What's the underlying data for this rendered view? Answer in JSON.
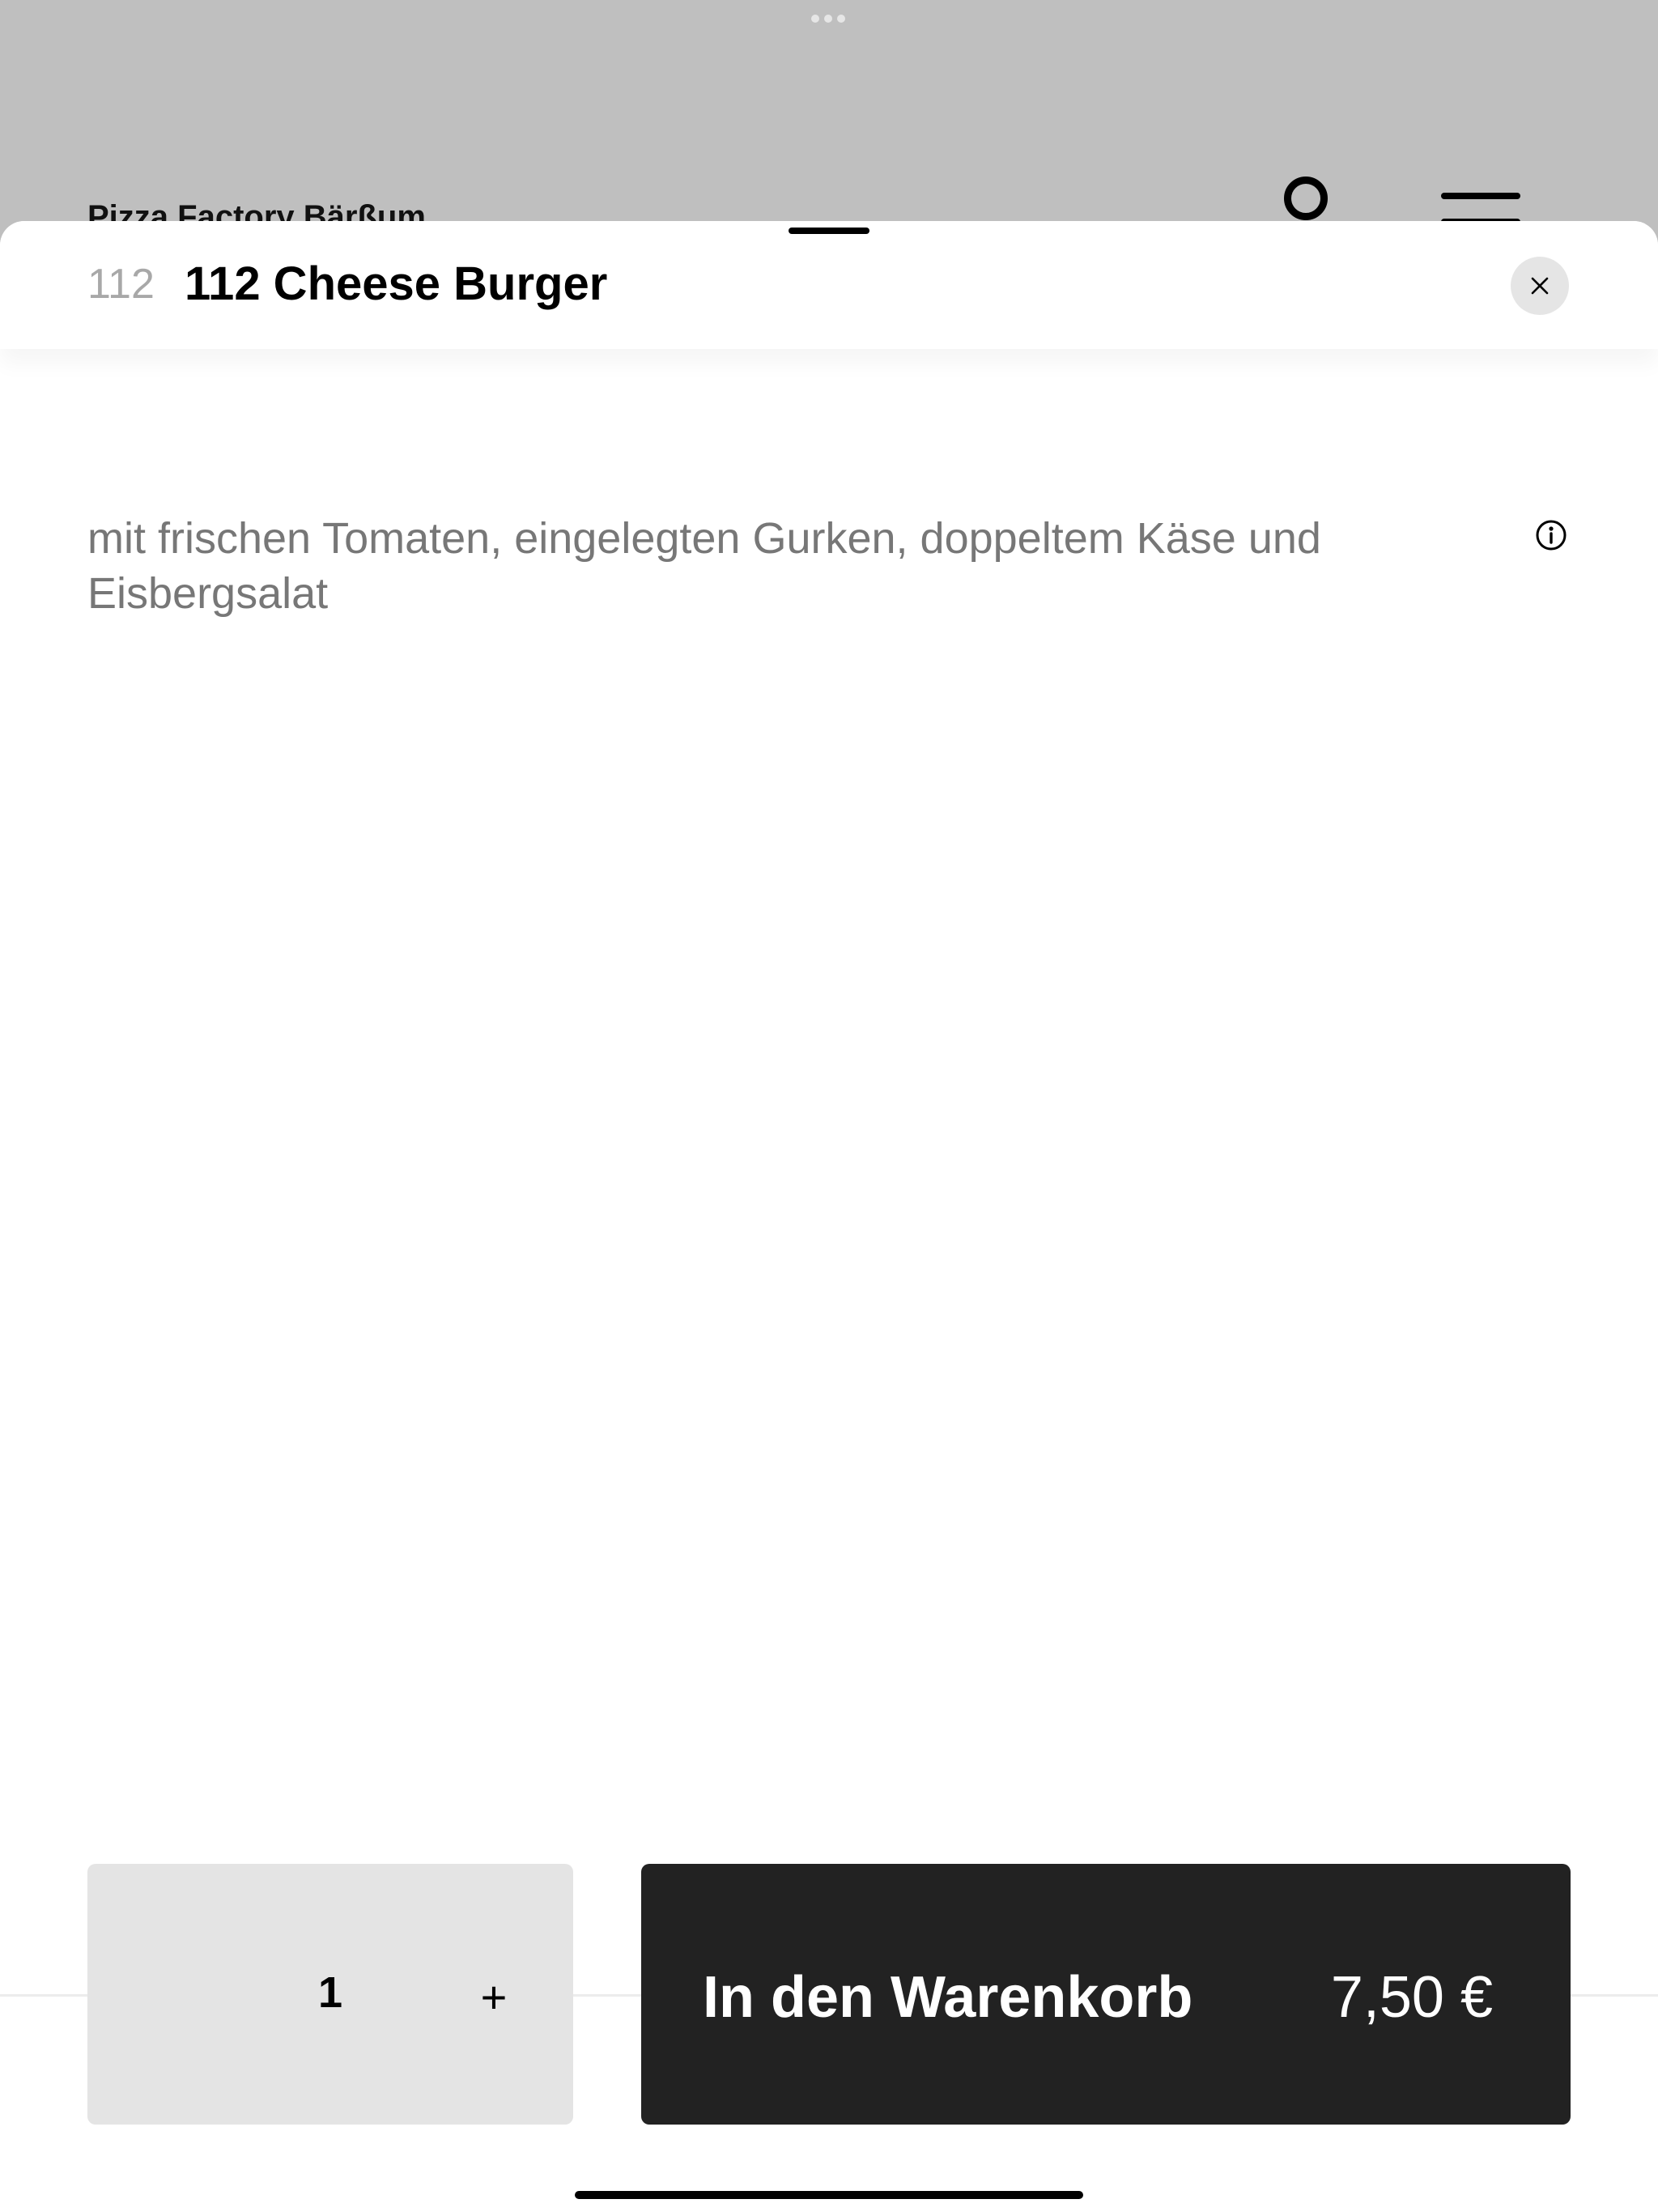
{
  "background_app": {
    "title": "Pizza Factory Bärßum"
  },
  "sheet": {
    "item_number": "112",
    "item_title": "112 Cheese Burger",
    "description": "mit frischen Tomaten, eingelegten Gurken, doppeltem Käse und Eisbergsalat"
  },
  "footer": {
    "quantity": "1",
    "plus_label": "+",
    "cart_label": "In den Warenkorb",
    "price": "7,50 €"
  },
  "icons": {
    "close": "close-icon",
    "info": "info-icon",
    "user": "user-icon",
    "menu": "menu-icon"
  },
  "colors": {
    "overlay_gray": "#bfbfbf",
    "cart_button": "#222222",
    "qty_box": "#e4e4e4",
    "muted_text": "#777777"
  }
}
